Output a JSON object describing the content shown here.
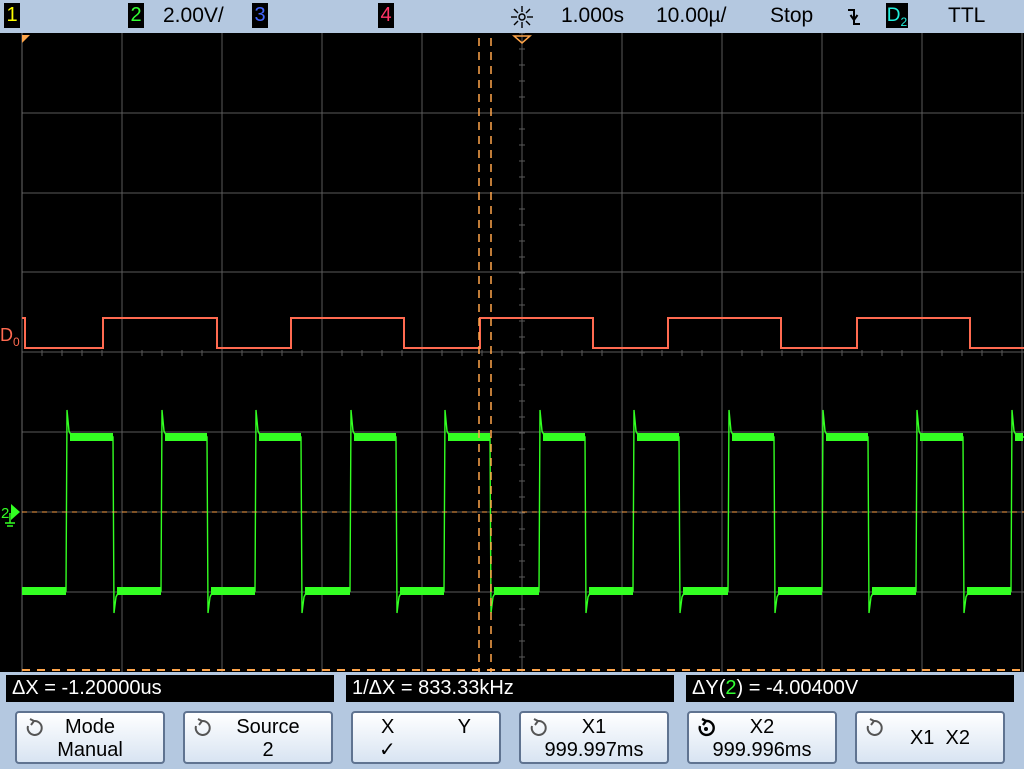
{
  "top_bar": {
    "ch1_label": "1",
    "ch2_label": "2",
    "ch2_scale": "2.00V/",
    "ch3_label": "3",
    "ch4_label": "4",
    "time_delay": "1.000s",
    "time_scale": "10.00µ/",
    "run_state": "Stop",
    "trigger_slope_icon": "falling-edge-icon",
    "trigger_source": "D",
    "trigger_source_sub": "2",
    "logic_threshold": "TTL"
  },
  "screen": {
    "digital_label": "D",
    "digital_label_sub": "0",
    "analog_marker_label": "2",
    "colors": {
      "grid": "#5a5a5a",
      "ch2": "#33ff22",
      "digital": "#ff6a50",
      "cursor": "#ffa54a",
      "ground_marker": "#33ff22"
    }
  },
  "measurements": {
    "delta_x": "ΔX = -1.20000us",
    "inv_delta_x": "1/ΔX = 833.33kHz",
    "delta_y_prefix": "ΔY(",
    "delta_y_channel": "2",
    "delta_y_suffix": ") = -4.00400V"
  },
  "softkeys": {
    "mode_label": "Mode",
    "mode_value": "Manual",
    "source_label": "Source",
    "source_value": "2",
    "x_label": "X",
    "y_label": "Y",
    "x_checked": "✓",
    "x1_label": "X1",
    "x1_value": "999.997ms",
    "x2_label": "X2",
    "x2_value": "999.996ms",
    "x1x2_label": "X1  X2"
  }
}
